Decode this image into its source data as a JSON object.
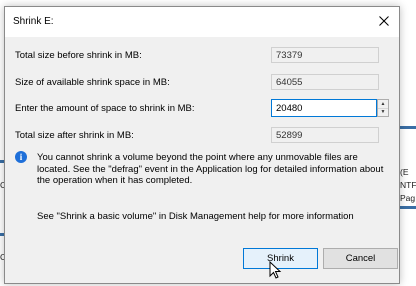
{
  "dialog": {
    "title": "Shrink E:",
    "close_icon": "close-icon"
  },
  "rows": {
    "total_before": {
      "label": "Total size before shrink in MB:",
      "value": "73379"
    },
    "available": {
      "label": "Size of available shrink space in MB:",
      "value": "64055"
    },
    "amount": {
      "label": "Enter the amount of space to shrink in MB:",
      "value": "20480"
    },
    "total_after": {
      "label": "Total size after shrink in MB:",
      "value": "52899"
    }
  },
  "info": {
    "icon": "info-icon",
    "text": "You cannot shrink a volume beyond the point where any unmovable files are located. See the \"defrag\" event in the Application log for detailed information about the operation when it has completed."
  },
  "help": {
    "text": "See \"Shrink a basic volume\" in Disk Management help for more information"
  },
  "buttons": {
    "shrink": "Shrink",
    "cancel": "Cancel"
  },
  "background": {
    "right_fragments": [
      "(E",
      "NTF",
      "Pag"
    ],
    "left_fragments": [
      "C",
      "C"
    ]
  },
  "colors": {
    "accent": "#0078d7",
    "info_icon": "#1e6fd9",
    "dialog_bg": "#f0f0f0"
  }
}
